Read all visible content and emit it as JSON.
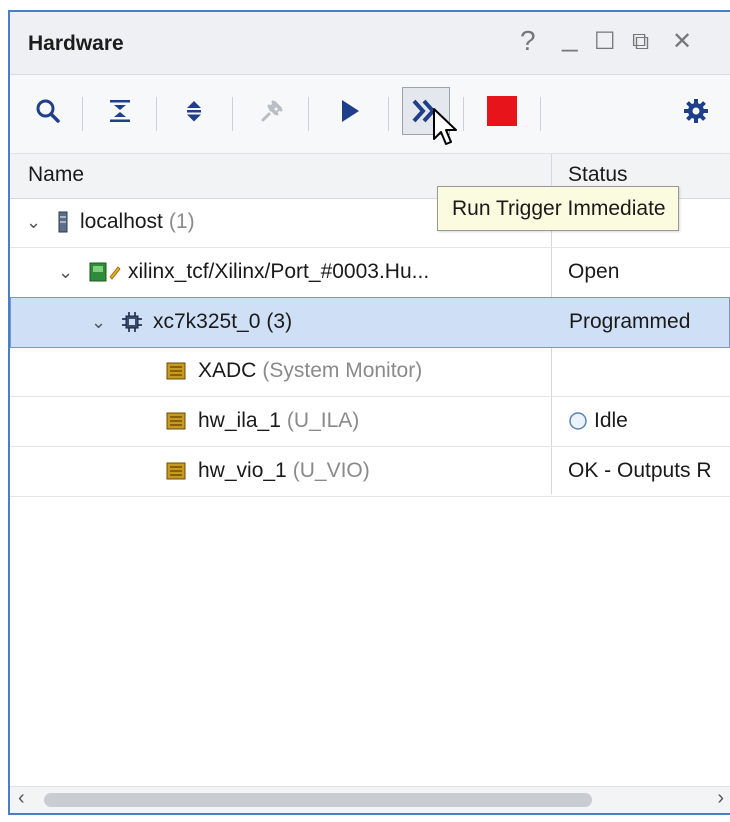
{
  "window": {
    "title": "Hardware",
    "controls": [
      "?",
      "_",
      "☐",
      "⧉",
      "✕"
    ]
  },
  "toolbar": {
    "buttons": [
      {
        "name": "search",
        "icon": "search-icon"
      },
      {
        "name": "collapse-all",
        "icon": "collapse-all-icon"
      },
      {
        "name": "expand-all",
        "icon": "expand-all-icon"
      },
      {
        "name": "auto-connect",
        "icon": "auto-connect-icon"
      },
      {
        "name": "run-trigger",
        "icon": "play-icon"
      },
      {
        "name": "run-trigger-immediate",
        "icon": "double-chevron-right-icon"
      },
      {
        "name": "stop-trigger",
        "icon": "stop-icon"
      },
      {
        "name": "settings",
        "icon": "gear-icon"
      }
    ],
    "tooltip": "Run Trigger Immediate"
  },
  "table": {
    "columns": [
      "Name",
      "Status"
    ],
    "rows": [
      {
        "name": "localhost",
        "suffix": "(1)",
        "status": ""
      },
      {
        "name": "xilinx_tcf/Xilinx/Port_#0003.Hu...",
        "suffix": "",
        "status": "Open"
      },
      {
        "name": "xc7k325t_0",
        "suffix": "(3)",
        "status": "Programmed"
      },
      {
        "name": "XADC",
        "suffix": "(System Monitor)",
        "status": ""
      },
      {
        "name": "hw_ila_1",
        "suffix": "(U_ILA)",
        "status": "Idle"
      },
      {
        "name": "hw_vio_1",
        "suffix": "(U_VIO)",
        "status": "OK - Outputs R"
      }
    ]
  },
  "colors": {
    "accent_border": "#4a7fc8",
    "selection": "#cfe0f6",
    "stop_red": "#e8141b",
    "play_blue": "#1f3f8a"
  }
}
